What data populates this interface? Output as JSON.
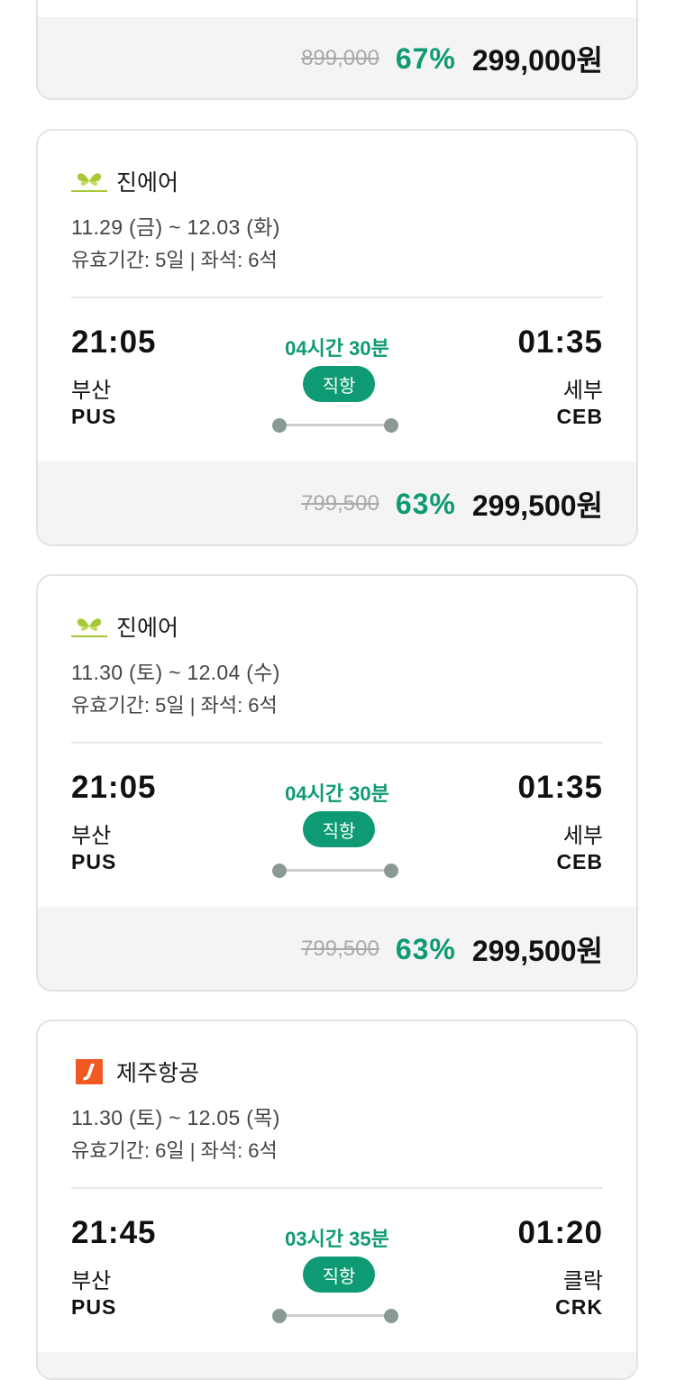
{
  "cards": [
    {
      "price": {
        "original": "899,000",
        "discount": "67%",
        "final": "299,000원"
      }
    },
    {
      "airline": "진에어",
      "logo": "jinair-logo",
      "dates": "11.29 (금) ~ 12.03 (화)",
      "validity": "유효기간: 5일 | 좌석: 6석",
      "departure": {
        "time": "21:05",
        "city": "부산",
        "code": "PUS"
      },
      "arrival": {
        "time": "01:35",
        "city": "세부",
        "code": "CEB"
      },
      "duration": "04시간 30분",
      "type": "직항",
      "price": {
        "original": "799,500",
        "discount": "63%",
        "final": "299,500원"
      }
    },
    {
      "airline": "진에어",
      "logo": "jinair-logo",
      "dates": "11.30 (토) ~ 12.04 (수)",
      "validity": "유효기간: 5일 | 좌석: 6석",
      "departure": {
        "time": "21:05",
        "city": "부산",
        "code": "PUS"
      },
      "arrival": {
        "time": "01:35",
        "city": "세부",
        "code": "CEB"
      },
      "duration": "04시간 30분",
      "type": "직항",
      "price": {
        "original": "799,500",
        "discount": "63%",
        "final": "299,500원"
      }
    },
    {
      "airline": "제주항공",
      "logo": "jejuair-logo",
      "dates": "11.30 (토) ~ 12.05 (목)",
      "validity": "유효기간: 6일 | 좌석: 6석",
      "departure": {
        "time": "21:45",
        "city": "부산",
        "code": "PUS"
      },
      "arrival": {
        "time": "01:20",
        "city": "클락",
        "code": "CRK"
      },
      "duration": "03시간 35분",
      "type": "직항"
    }
  ],
  "colors": {
    "accent": "#0e9a72",
    "jinair": "#a6c935",
    "jejuair": "#f05a22"
  }
}
